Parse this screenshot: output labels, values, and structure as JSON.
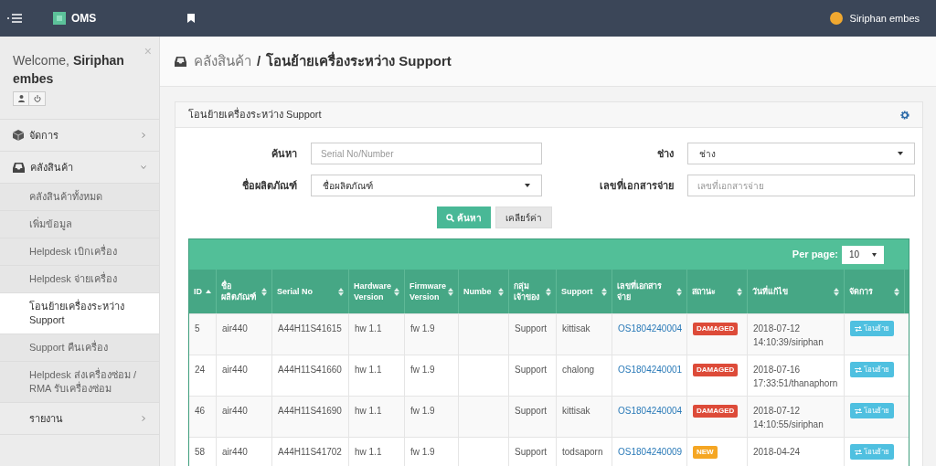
{
  "topbar": {
    "app_name": "OMS",
    "user_name": "Siriphan embes"
  },
  "sidebar": {
    "welcome": "Welcome,",
    "user": "Siriphan embes",
    "close": "×",
    "menu": [
      {
        "label": "จัดการ",
        "expanded": false
      },
      {
        "label": "คลังสินค้า",
        "expanded": true,
        "children": [
          {
            "label": "คลังสินค้าทั้งหมด",
            "selected": false
          },
          {
            "label": "เพิ่มข้อมูล",
            "selected": false
          },
          {
            "label": "Helpdesk เบิกเครื่อง",
            "selected": false
          },
          {
            "label": "Helpdesk จ่ายเครื่อง",
            "selected": false
          },
          {
            "label": "โอนย้ายเครื่องระหว่าง Support",
            "selected": true
          },
          {
            "label": "Support คืนเครื่อง",
            "selected": false
          },
          {
            "label": "Helpdesk ส่งเครื่องซ่อม / RMA รับเครื่องซ่อม",
            "selected": false
          }
        ]
      },
      {
        "label": "รายงาน",
        "expanded": false
      }
    ]
  },
  "page_title": {
    "parent": "คลังสินค้า",
    "separator": "/",
    "current": "โอนย้ายเครื่องระหว่าง Support"
  },
  "panel": {
    "title": "โอนย้ายเครื่องระหว่าง Support",
    "filters": [
      {
        "label": "ค้นหา",
        "kind": "input",
        "placeholder": "Serial No/Number"
      },
      {
        "label": "ช่าง",
        "kind": "select",
        "value": "ช่าง"
      },
      {
        "label": "ชื่อผลิตภัณฑ์",
        "kind": "select",
        "value": "ชื่อผลิตภัณฑ์"
      },
      {
        "label": "เลขที่เอกสารจ่าย",
        "kind": "input",
        "placeholder": "เลขที่เอกสารจ่าย"
      }
    ],
    "search_button": "ค้นหา",
    "clear_button": "เคลียร์ค่า",
    "per_page_label": "Per page:",
    "per_page": "10",
    "table": {
      "columns": [
        {
          "label": "ID",
          "sorted": true
        },
        {
          "label": "ชื่อ ผลิตภัณฑ์",
          "sorted": false
        },
        {
          "label": "Serial No",
          "sorted": false
        },
        {
          "label": "Hardware Version",
          "sorted": false
        },
        {
          "label": "Firmware Version",
          "sorted": false
        },
        {
          "label": "Numbe",
          "sorted": false
        },
        {
          "label": "กลุ่ม เจ้าของ",
          "sorted": false
        },
        {
          "label": "Support",
          "sorted": false
        },
        {
          "label": "เลขที่เอกสาร จ่าย",
          "sorted": false
        },
        {
          "label": "สถานะ",
          "sorted": false
        },
        {
          "label": "วันที่แก้ไข",
          "sorted": false
        },
        {
          "label": "จัดการ",
          "sorted": false
        }
      ],
      "rows": [
        {
          "id": "5",
          "product": "air440",
          "serial": "A44H11S41615",
          "hw": "hw 1.1",
          "fw": "fw 1.9",
          "group": "Support",
          "support": "kittisak",
          "doc": "OS1804240004",
          "status": {
            "label": "DAMAGED",
            "kind": "danger"
          },
          "date": "2018-07-12",
          "time_user": "14:10:39/siriphan",
          "action": "โอนย้าย"
        },
        {
          "id": "24",
          "product": "air440",
          "serial": "A44H11S41660",
          "hw": "hw 1.1",
          "fw": "fw 1.9",
          "group": "Support",
          "support": "chalong",
          "doc": "OS1804240001",
          "status": {
            "label": "DAMAGED",
            "kind": "danger"
          },
          "date": "2018-07-16",
          "time_user": "17:33:51/thanaphorn",
          "action": "โอนย้าย"
        },
        {
          "id": "46",
          "product": "air440",
          "serial": "A44H11S41690",
          "hw": "hw 1.1",
          "fw": "fw 1.9",
          "group": "Support",
          "support": "kittisak",
          "doc": "OS1804240004",
          "status": {
            "label": "DAMAGED",
            "kind": "danger"
          },
          "date": "2018-07-12",
          "time_user": "14:10:55/siriphan",
          "action": "โอนย้าย"
        },
        {
          "id": "58",
          "product": "air440",
          "serial": "A44H11S41702",
          "hw": "hw 1.1",
          "fw": "fw 1.9",
          "group": "Support",
          "support": "todsaporn",
          "doc": "OS1804240009",
          "status": {
            "label": "NEW",
            "kind": "warning"
          },
          "date": "2018-04-24",
          "action": "โอนย้าย"
        }
      ]
    }
  }
}
